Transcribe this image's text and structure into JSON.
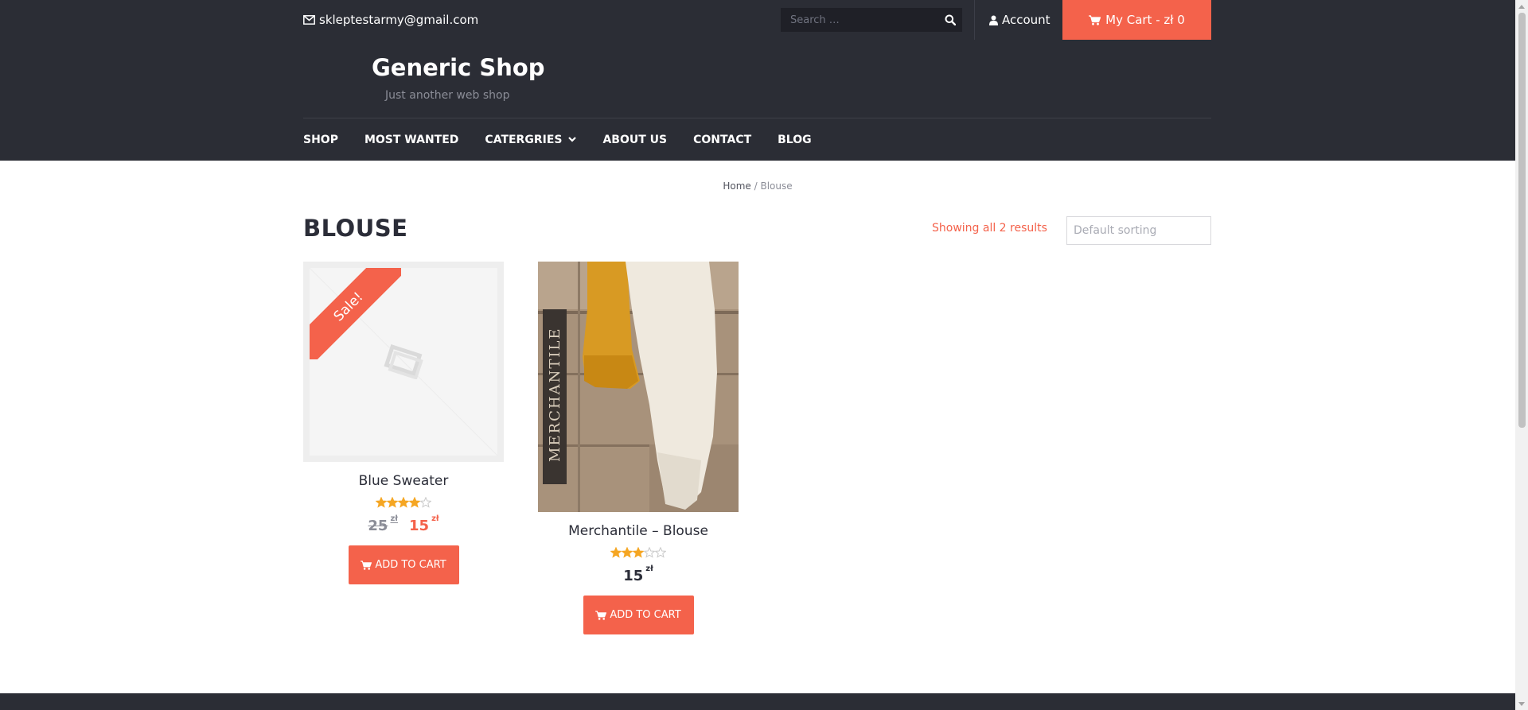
{
  "topbar": {
    "email": "skleptestarmy@gmail.com",
    "search_placeholder": "Search …",
    "account_label": "Account",
    "cart_label": "My Cart - zł 0"
  },
  "header": {
    "site_title": "Generic Shop",
    "tagline": "Just another web shop",
    "nav": [
      "SHOP",
      "MOST WANTED",
      "CATERGRIES",
      "ABOUT US",
      "CONTACT",
      "BLOG"
    ]
  },
  "breadcrumb": {
    "home": "Home",
    "separator": " / ",
    "current": "Blouse"
  },
  "page": {
    "title": "BLOUSE",
    "result_count": "Showing all 2 results",
    "sort_placeholder": "Default sorting"
  },
  "products": [
    {
      "name": "Blue Sweater",
      "rating": 4,
      "rating_max": 5,
      "sale_badge": "Sale!",
      "price_old": "25",
      "price": "15",
      "currency": "zł",
      "button_label": "ADD TO CART"
    },
    {
      "name": "Merchantile – Blouse",
      "rating": 3,
      "rating_max": 5,
      "price": "15",
      "currency": "zł",
      "photo_text": "MERCHANTILE",
      "button_label": "ADD TO CART"
    }
  ],
  "colors": {
    "accent": "#f4624b",
    "dark": "#2b2d35",
    "star": "#f5a623"
  }
}
